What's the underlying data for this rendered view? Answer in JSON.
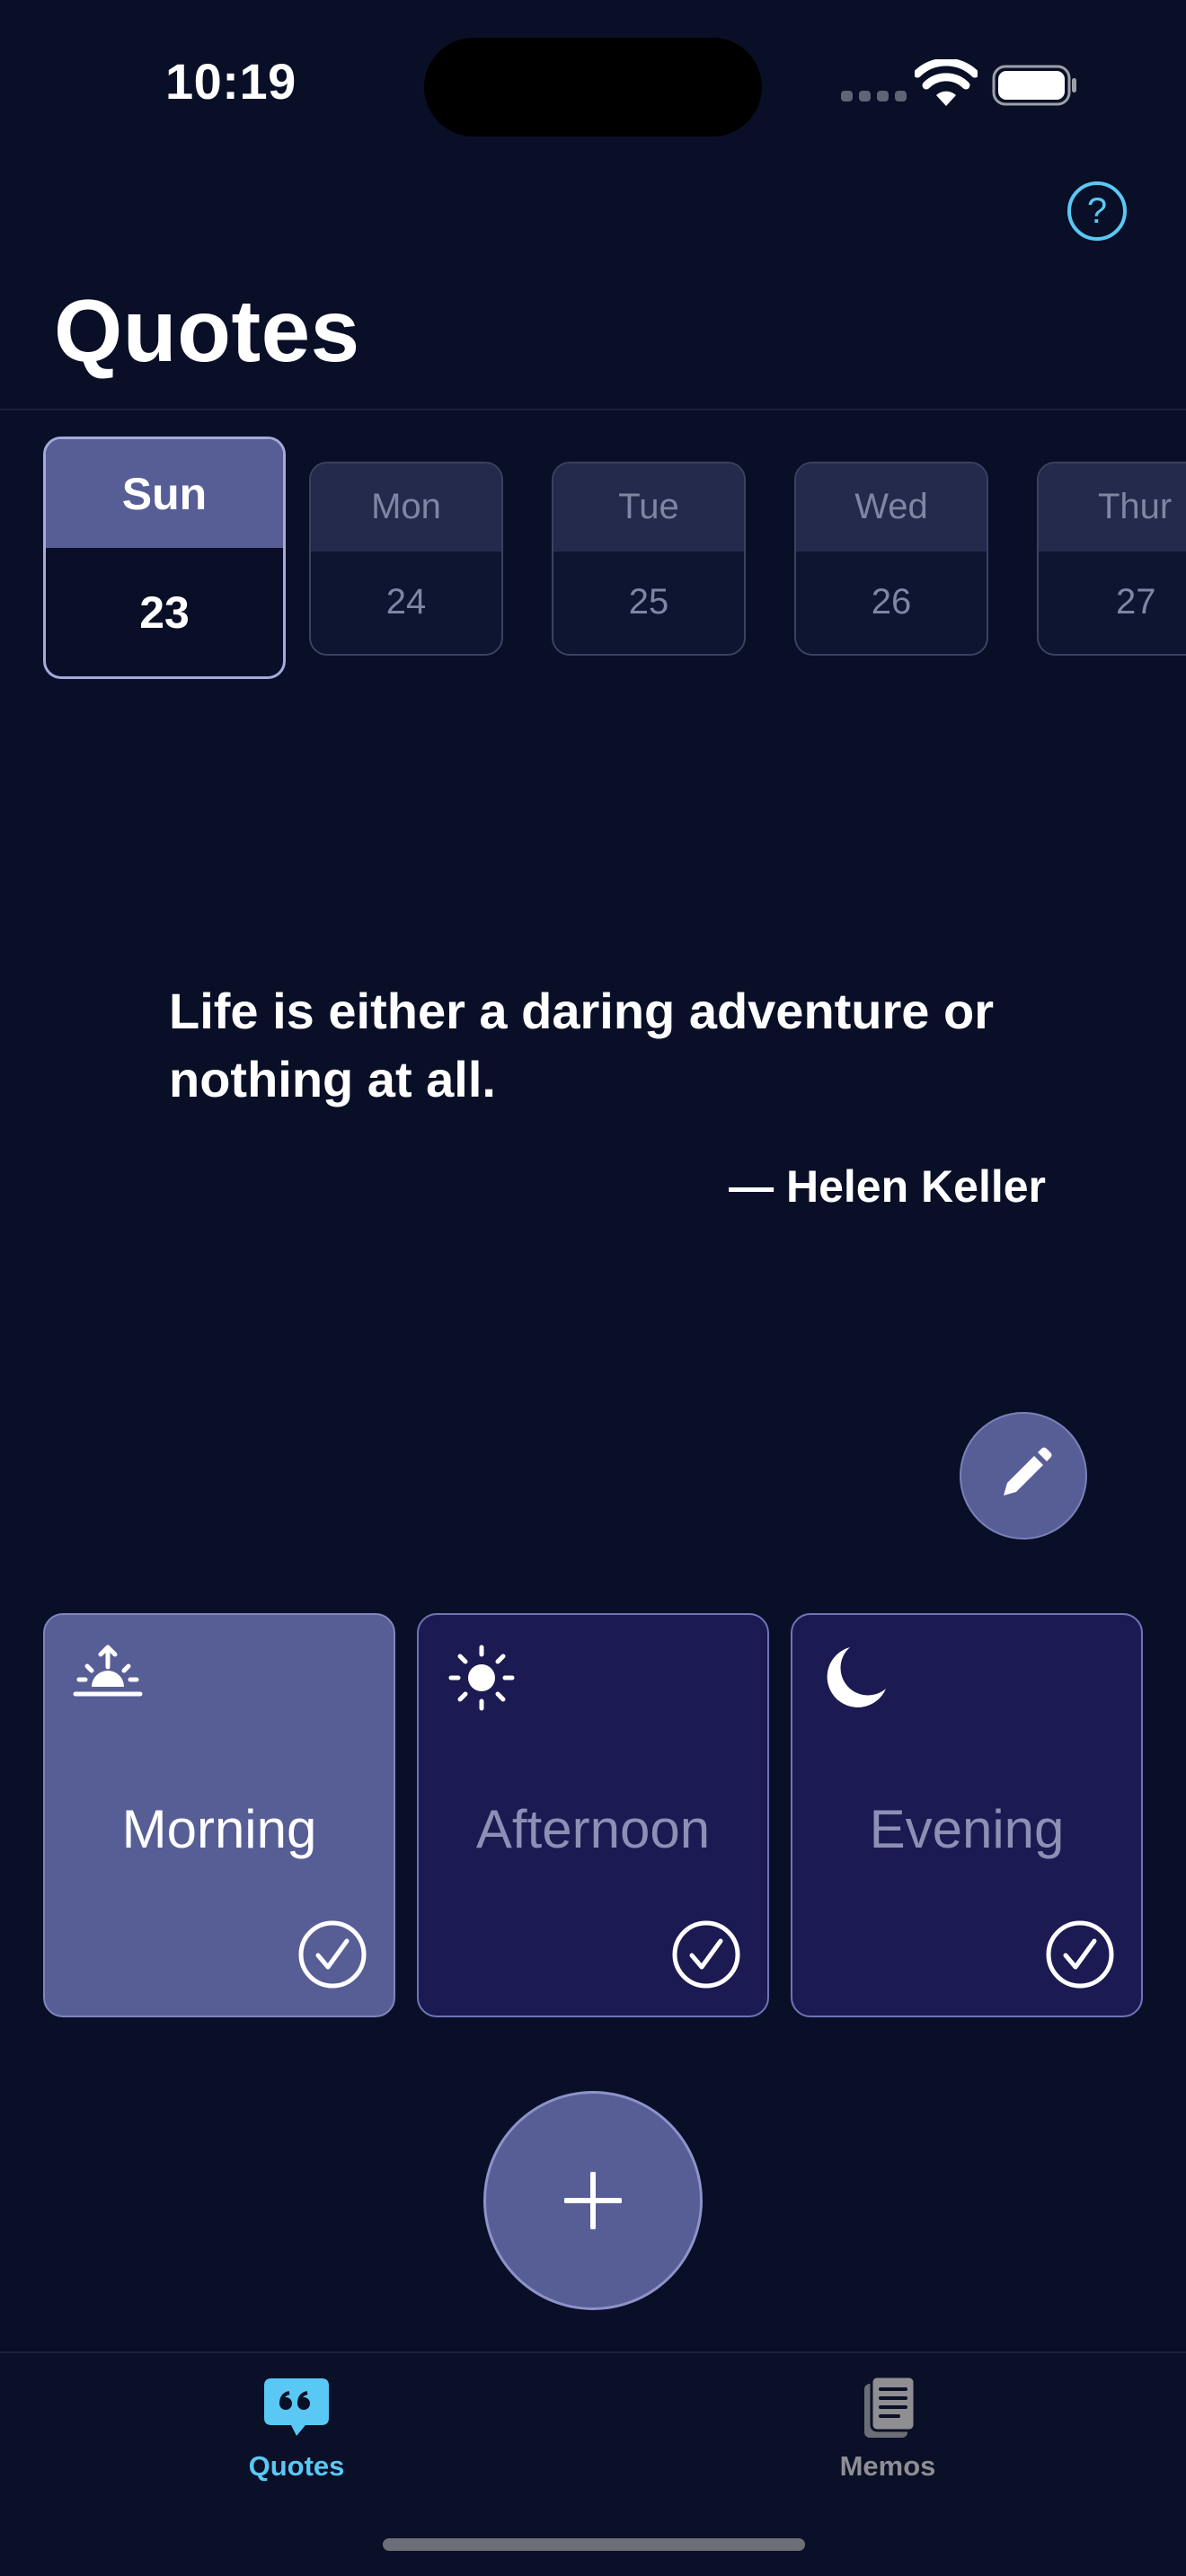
{
  "status_bar": {
    "time": "10:19"
  },
  "header": {
    "title": "Quotes",
    "help_glyph": "?"
  },
  "days": [
    {
      "name": "Sun",
      "date": "23",
      "selected": true
    },
    {
      "name": "Mon",
      "date": "24",
      "selected": false
    },
    {
      "name": "Tue",
      "date": "25",
      "selected": false
    },
    {
      "name": "Wed",
      "date": "26",
      "selected": false
    },
    {
      "name": "Thur",
      "date": "27",
      "selected": false
    }
  ],
  "quote": {
    "text": "Life is either a daring adventure or nothing at all.",
    "author": "— Helen Keller"
  },
  "time_of_day": [
    {
      "label": "Morning",
      "icon": "sunrise-icon",
      "active": true
    },
    {
      "label": "Afternoon",
      "icon": "sun-icon",
      "active": false
    },
    {
      "label": "Evening",
      "icon": "moon-icon",
      "active": false
    }
  ],
  "tab_bar": {
    "items": [
      {
        "label": "Quotes",
        "icon": "quote-bubble-icon",
        "active": true
      },
      {
        "label": "Memos",
        "icon": "memo-document-icon",
        "active": false
      }
    ]
  },
  "colors": {
    "background": "#090f27",
    "accent": "#5ac8f5",
    "selected_card": "#575e96",
    "card_dark": "#1c1a52"
  }
}
